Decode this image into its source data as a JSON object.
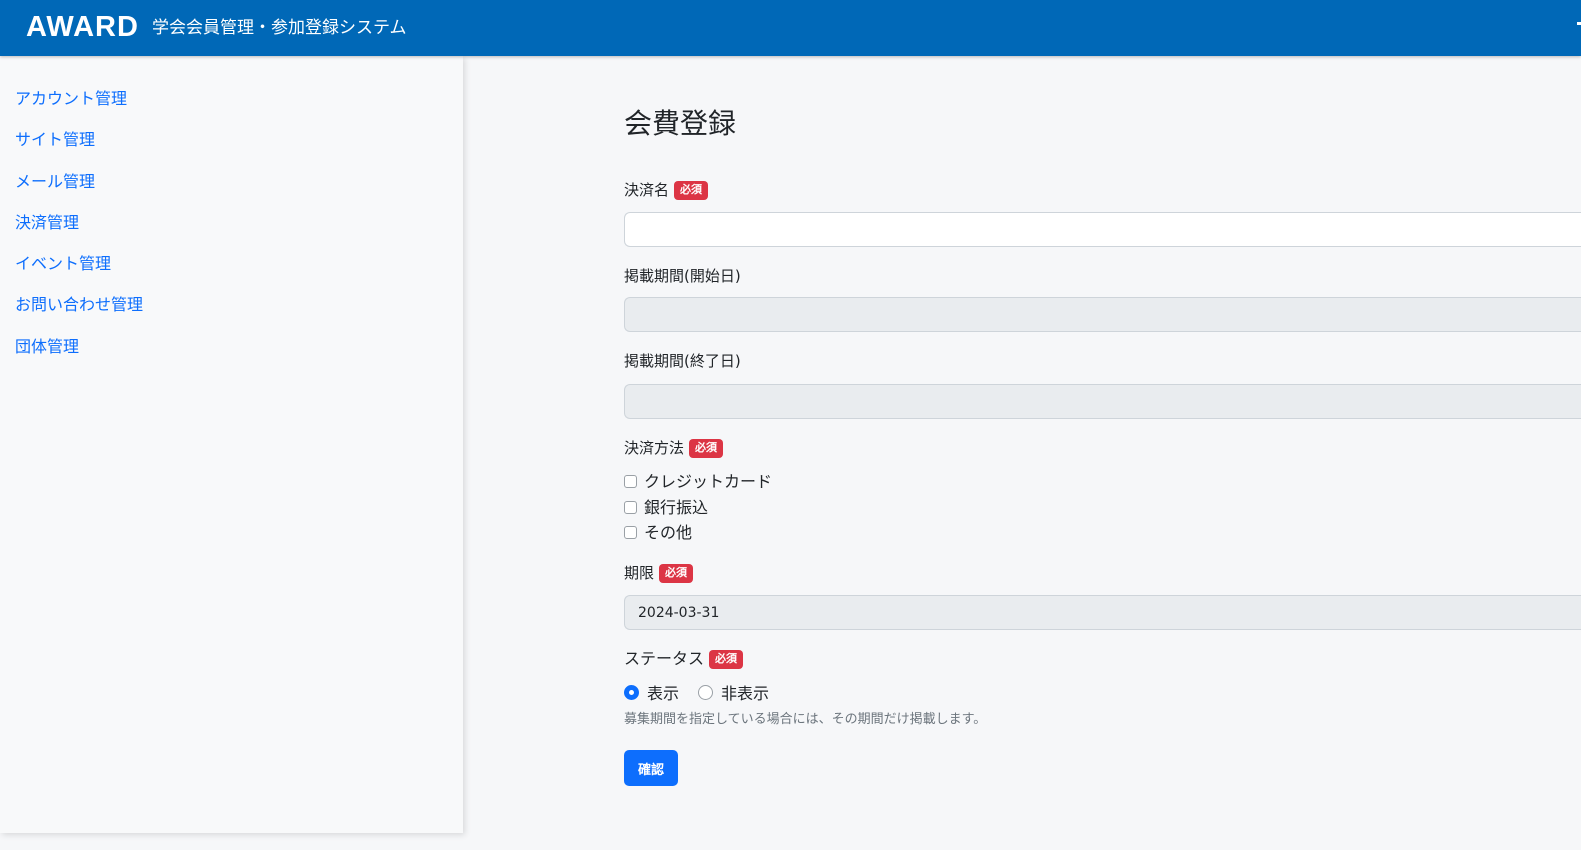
{
  "header": {
    "logo": "AWARD",
    "title": "学会会員管理・参加登録システム"
  },
  "sidebar": {
    "items": [
      {
        "label": "アカウント管理"
      },
      {
        "label": "サイト管理"
      },
      {
        "label": "メール管理"
      },
      {
        "label": "決済管理"
      },
      {
        "label": "イベント管理"
      },
      {
        "label": "お問い合わせ管理"
      },
      {
        "label": "団体管理"
      }
    ]
  },
  "form": {
    "title": "会費登録",
    "required_badge": "必須",
    "payment_name": {
      "label": "決済名",
      "value": ""
    },
    "period_start": {
      "label": "掲載期間(開始日)",
      "value": ""
    },
    "period_end": {
      "label": "掲載期間(終了日)",
      "value": ""
    },
    "payment_method": {
      "label": "決済方法",
      "options": [
        {
          "label": "クレジットカード",
          "checked": false
        },
        {
          "label": "銀行振込",
          "checked": false
        },
        {
          "label": "その他",
          "checked": false
        }
      ]
    },
    "deadline": {
      "label": "期限",
      "value": "2024-03-31"
    },
    "status": {
      "label": "ステータス",
      "options": [
        {
          "label": "表示",
          "selected": true
        },
        {
          "label": "非表示",
          "selected": false
        }
      ],
      "help": "募集期間を指定している場合には、その期間だけ掲載します。"
    },
    "confirm_button": "確認"
  },
  "colors": {
    "header_bg": "#0068b7",
    "link": "#0d6efd",
    "badge": "#dc3545",
    "primary_button": "#0d6efd"
  }
}
